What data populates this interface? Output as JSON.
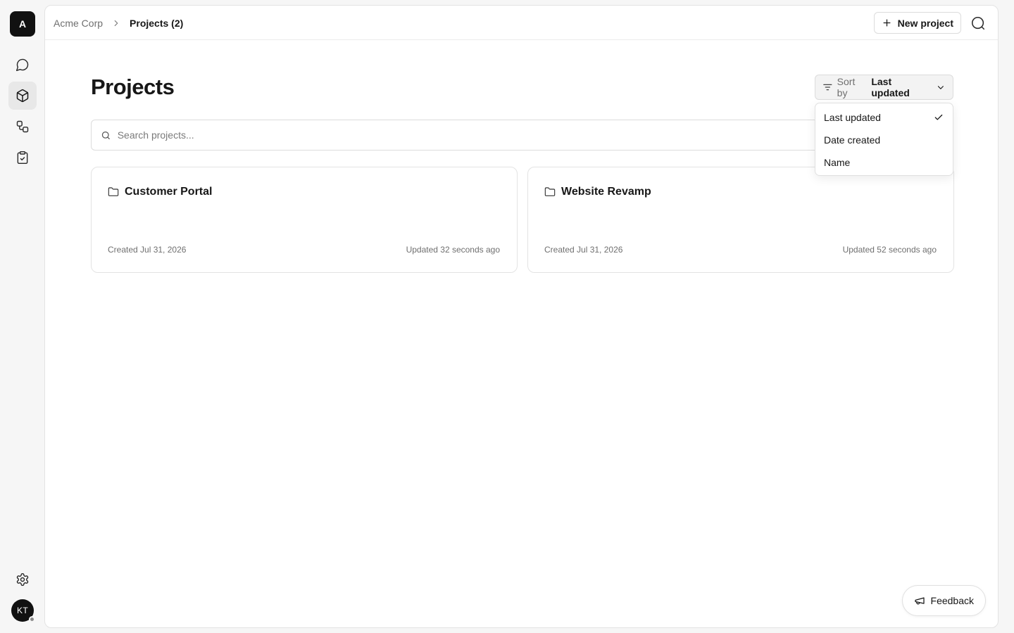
{
  "workspace": {
    "initial": "A"
  },
  "rail": {
    "items": [
      {
        "name": "chat",
        "icon": "chat-bubble-icon"
      },
      {
        "name": "projects",
        "icon": "cube-icon",
        "active": true
      },
      {
        "name": "workflows",
        "icon": "workflow-icon"
      },
      {
        "name": "tasks",
        "icon": "clipboard-check-icon"
      }
    ],
    "settings_icon": "gear-icon",
    "user_initials": "KT"
  },
  "breadcrumb": {
    "root": "Acme Corp",
    "current": "Projects (2)"
  },
  "header": {
    "new_project_label": "New project"
  },
  "page": {
    "title": "Projects"
  },
  "sort": {
    "prefix": "Sort by",
    "value": "Last updated",
    "options": [
      "Last updated",
      "Date created",
      "Name"
    ],
    "selected": "Last updated"
  },
  "search": {
    "placeholder": "Search projects...",
    "value": ""
  },
  "projects": [
    {
      "name": "Customer Portal",
      "created": "Created Jul 31, 2026",
      "updated": "Updated 32 seconds ago"
    },
    {
      "name": "Website Revamp",
      "created": "Created Jul 31, 2026",
      "updated": "Updated 52 seconds ago"
    }
  ],
  "feedback": {
    "label": "Feedback"
  },
  "colors": {
    "accent": "#111111",
    "border": "#e3e3e3",
    "muted_text": "#6f6f6f"
  }
}
